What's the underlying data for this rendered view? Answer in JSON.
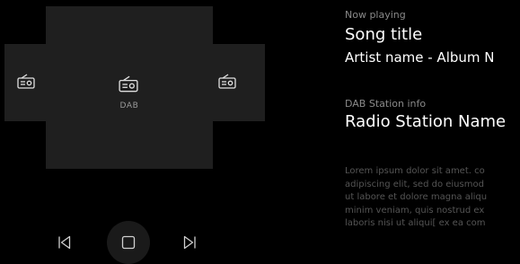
{
  "carousel": {
    "center_label": "DAB",
    "icon": "radio-icon"
  },
  "controls": {
    "previous_icon": "skip-previous-icon",
    "stop_icon": "stop-icon",
    "next_icon": "skip-next-icon"
  },
  "now_playing": {
    "heading": "Now playing",
    "song_title": "Song title",
    "artist_album": "Artist name - Album N"
  },
  "station": {
    "heading": "DAB Station info",
    "name": "Radio Station Name",
    "description_lines": [
      "Lorem ipsum dolor sit amet. co",
      "adipiscing elit, sed do eiusmod",
      "ut labore et dolore magna aliqu",
      "minim veniam, quis nostrud ex",
      "laboris nisi ut aliqui[ ex ea com"
    ]
  },
  "colors": {
    "background": "#000000",
    "card": "#1f1f1f",
    "text_primary": "#ffffff",
    "text_secondary": "#8a8a8a",
    "text_muted": "#555555"
  }
}
